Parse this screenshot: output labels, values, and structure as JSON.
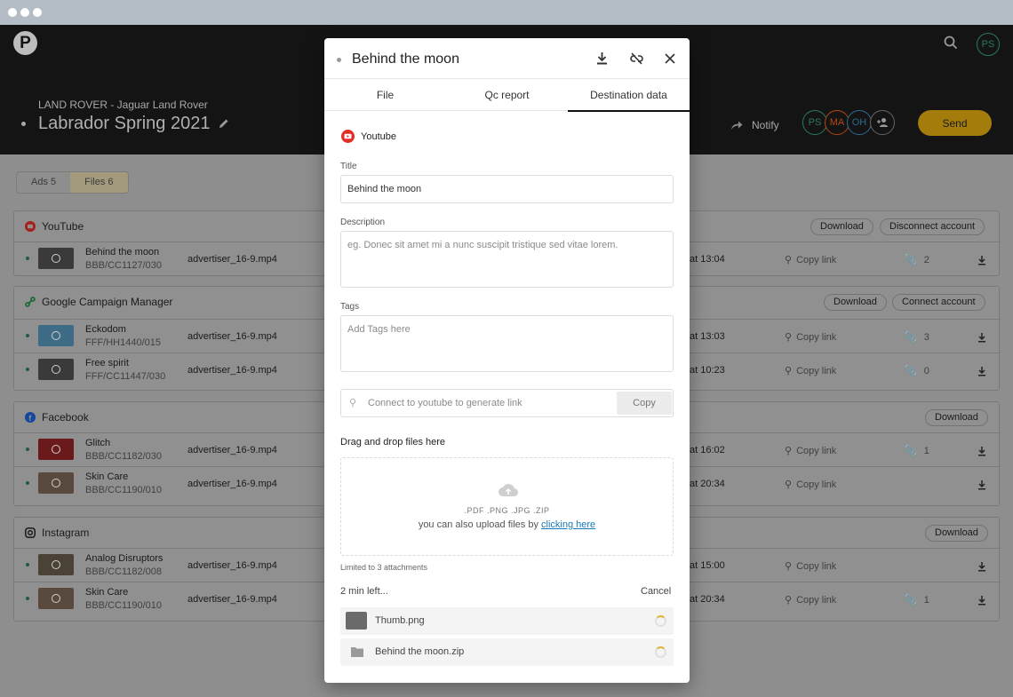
{
  "app": {
    "logo_letter": "P",
    "brand": "LAND ROVER - Jaguar Land Rover",
    "campaign": "Labrador Spring 2021",
    "notify": "Notify",
    "send": "Send",
    "user_initials": "PS"
  },
  "avatars": [
    "PS",
    "MA",
    "OH"
  ],
  "tabs": [
    {
      "label": "Ads 5"
    },
    {
      "label": "Files 6"
    }
  ],
  "channels": [
    {
      "name": "YouTube",
      "buttons": [
        "Download",
        "Disconnect account"
      ],
      "rows": [
        {
          "name": "Behind the moon",
          "code": "BBB/CC1127/030",
          "file": "advertiser_16-9.mp4",
          "time": "at 13:04",
          "link": "Copy link",
          "attachments": "2"
        }
      ]
    },
    {
      "name": "Google Campaign Manager",
      "buttons": [
        "Download",
        "Connect account"
      ],
      "rows": [
        {
          "name": "Eckodom",
          "code": "FFF/HH1440/015",
          "file": "advertiser_16-9.mp4",
          "time": "at 13:03",
          "link": "Copy link",
          "attachments": "3"
        },
        {
          "name": "Free spirit",
          "code": "FFF/CC11447/030",
          "file": "advertiser_16-9.mp4",
          "time": "at 10:23",
          "link": "Copy link",
          "attachments": "0"
        }
      ]
    },
    {
      "name": "Facebook",
      "buttons": [
        "Download"
      ],
      "rows": [
        {
          "name": "Glitch",
          "code": "BBB/CC1182/030",
          "file": "advertiser_16-9.mp4",
          "time": "at 16:02",
          "link": "Copy link",
          "attachments": "1"
        },
        {
          "name": "Skin Care",
          "code": "BBB/CC1190/010",
          "file": "advertiser_16-9.mp4",
          "time": "at 20:34",
          "link": "Copy link",
          "attachments": ""
        }
      ]
    },
    {
      "name": "Instagram",
      "buttons": [
        "Download"
      ],
      "rows": [
        {
          "name": "Analog Disruptors",
          "code": "BBB/CC1182/008",
          "file": "advertiser_16-9.mp4",
          "time": "at 15:00",
          "link": "Copy link",
          "attachments": ""
        },
        {
          "name": "Skin Care",
          "code": "BBB/CC1190/010",
          "file": "advertiser_16-9.mp4",
          "time": "at 20:34",
          "link": "Copy link",
          "attachments": "1"
        }
      ]
    }
  ],
  "modal": {
    "title": "Behind the moon",
    "tabs": [
      "File",
      "Qc report",
      "Destination data"
    ],
    "platform": "Youtube",
    "title_label": "Title",
    "title_value": "Behind the moon",
    "description_label": "Description",
    "description_placeholder": "eg. Donec sit amet mi a nunc suscipit tristique sed vitae lorem.",
    "tags_label": "Tags",
    "tags_placeholder": "Add Tags here",
    "link_placeholder": "Connect to youtube to generate link",
    "copy": "Copy",
    "upload_title": "Drag and drop files here",
    "formats": ".PDF .PNG .JPG .ZIP",
    "upload_hint": "you can also upload files by",
    "upload_link": "clicking here",
    "limit": "Limited to 3 attachments",
    "time_left": "2 min left...",
    "cancel": "Cancel",
    "files": [
      "Thumb.png",
      "Behind the moon.zip"
    ]
  },
  "colors": {
    "accent": "#e2b236",
    "youtube": "#e52d27",
    "google": "#34a853",
    "facebook": "#1877f2"
  }
}
